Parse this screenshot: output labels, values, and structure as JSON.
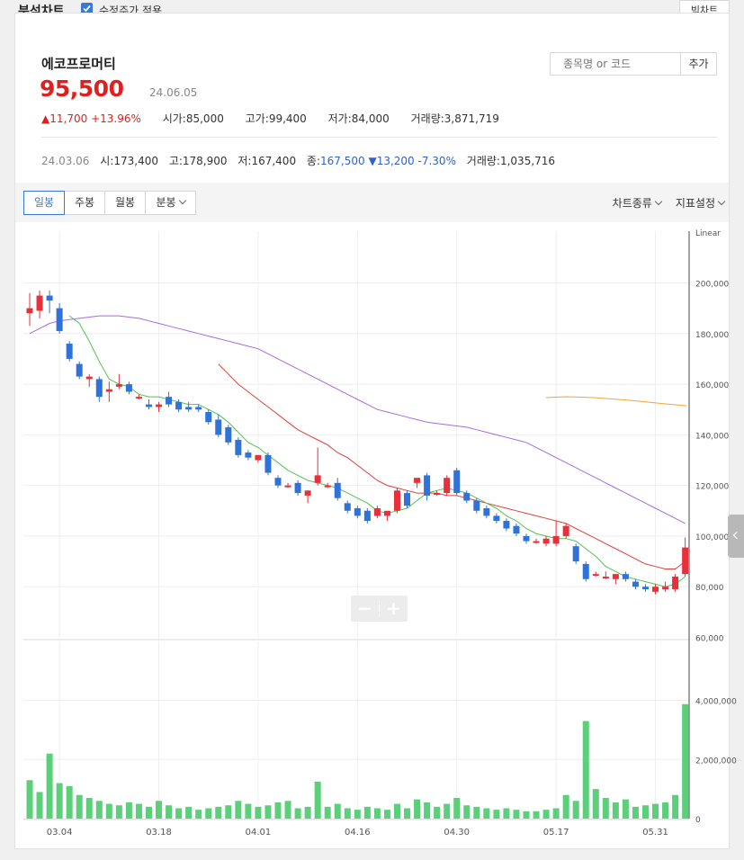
{
  "topbar": {
    "title": "분석차트",
    "adjusted_label": "수정주가 적용",
    "big_chart_button": "빅차트"
  },
  "stock": {
    "name": "에코프로머티",
    "price": "95,500",
    "date": "24.06.05",
    "change": "11,700",
    "change_pct": "+13.96%",
    "open_label": "시가",
    "open": "85,000",
    "high_label": "고가",
    "high": "99,400",
    "low_label": "저가",
    "low": "84,000",
    "volume_label": "거래량",
    "volume": "3,871,719"
  },
  "search": {
    "placeholder": "종목명 or 코드",
    "add_button": "추가"
  },
  "history": {
    "date": "24.03.06",
    "open_label": "시",
    "open": "173,400",
    "high_label": "고",
    "high": "178,900",
    "low_label": "저",
    "low": "167,400",
    "close_label": "종",
    "close": "167,500",
    "change": "13,200",
    "change_pct": "-7.30%",
    "volume_label": "거래량",
    "volume": "1,035,716"
  },
  "tabs": [
    {
      "label": "일봉",
      "active": true
    },
    {
      "label": "주봉",
      "active": false
    },
    {
      "label": "월봉",
      "active": false
    },
    {
      "label": "분봉",
      "active": false,
      "dropdown": true
    }
  ],
  "dropdowns": {
    "chart_type": "차트종류",
    "indicator": "지표설정"
  },
  "colors": {
    "up": "#e8303a",
    "down": "#2f73d9",
    "ma5": "#55c155",
    "ma20": "#e0403a",
    "ma60": "#a86ae0",
    "ma120": "#f2a23a",
    "volume": "#5ccf7a"
  },
  "chart_data": [
    {
      "type": "candlestick",
      "scale_label": "Linear",
      "ylim": [
        60000,
        200000
      ],
      "y_ticks": [
        60000,
        80000,
        100000,
        120000,
        140000,
        160000,
        180000,
        200000
      ],
      "y_tick_labels": [
        "60,000",
        "80,000",
        "100,000",
        "120,000",
        "140,000",
        "160,000",
        "180,000",
        "200,000"
      ],
      "x_tick_labels": [
        "03.04",
        "03.18",
        "04.01",
        "04.16",
        "04.30",
        "05.17",
        "05.31"
      ],
      "x_tick_index": [
        3,
        13,
        23,
        33,
        43,
        53,
        63
      ],
      "candles": [
        {
          "o": 188000,
          "h": 196000,
          "l": 183000,
          "c": 190000
        },
        {
          "o": 189000,
          "h": 197000,
          "l": 186000,
          "c": 195000
        },
        {
          "o": 195000,
          "h": 197000,
          "l": 188000,
          "c": 193000
        },
        {
          "o": 190000,
          "h": 192000,
          "l": 180000,
          "c": 181000
        },
        {
          "o": 176000,
          "h": 177000,
          "l": 169000,
          "c": 170000
        },
        {
          "o": 168000,
          "h": 169000,
          "l": 162000,
          "c": 163000
        },
        {
          "o": 162000,
          "h": 164000,
          "l": 159000,
          "c": 163000
        },
        {
          "o": 162000,
          "h": 163000,
          "l": 153000,
          "c": 155000
        },
        {
          "o": 157000,
          "h": 161000,
          "l": 153000,
          "c": 158000
        },
        {
          "o": 159000,
          "h": 164000,
          "l": 158000,
          "c": 160000
        },
        {
          "o": 160000,
          "h": 161000,
          "l": 156000,
          "c": 157000
        },
        {
          "o": 155000,
          "h": 156000,
          "l": 154000,
          "c": 155000
        },
        {
          "o": 152000,
          "h": 154000,
          "l": 150000,
          "c": 151000
        },
        {
          "o": 151000,
          "h": 153000,
          "l": 149000,
          "c": 152000
        },
        {
          "o": 155000,
          "h": 157000,
          "l": 151000,
          "c": 152000
        },
        {
          "o": 153000,
          "h": 154000,
          "l": 149000,
          "c": 150000
        },
        {
          "o": 151000,
          "h": 153000,
          "l": 149000,
          "c": 150000
        },
        {
          "o": 151000,
          "h": 152000,
          "l": 149000,
          "c": 150000
        },
        {
          "o": 149000,
          "h": 150000,
          "l": 144000,
          "c": 145000
        },
        {
          "o": 146000,
          "h": 148000,
          "l": 139000,
          "c": 140000
        },
        {
          "o": 143000,
          "h": 144000,
          "l": 136000,
          "c": 137000
        },
        {
          "o": 138000,
          "h": 139000,
          "l": 131000,
          "c": 132000
        },
        {
          "o": 133000,
          "h": 134000,
          "l": 130000,
          "c": 131000
        },
        {
          "o": 130000,
          "h": 132000,
          "l": 129000,
          "c": 132000
        },
        {
          "o": 132000,
          "h": 133000,
          "l": 124000,
          "c": 125000
        },
        {
          "o": 123000,
          "h": 124000,
          "l": 119000,
          "c": 120000
        },
        {
          "o": 120000,
          "h": 121000,
          "l": 119000,
          "c": 120000
        },
        {
          "o": 121000,
          "h": 122000,
          "l": 116000,
          "c": 117000
        },
        {
          "o": 116000,
          "h": 118000,
          "l": 113000,
          "c": 118000
        },
        {
          "o": 121000,
          "h": 135000,
          "l": 120000,
          "c": 124000
        },
        {
          "o": 120000,
          "h": 121000,
          "l": 119000,
          "c": 120000
        },
        {
          "o": 121000,
          "h": 123000,
          "l": 114000,
          "c": 115000
        },
        {
          "o": 113000,
          "h": 114000,
          "l": 109000,
          "c": 110000
        },
        {
          "o": 111000,
          "h": 112000,
          "l": 107000,
          "c": 108000
        },
        {
          "o": 110000,
          "h": 111000,
          "l": 105000,
          "c": 106000
        },
        {
          "o": 108000,
          "h": 112000,
          "l": 107000,
          "c": 111000
        },
        {
          "o": 108000,
          "h": 109000,
          "l": 106000,
          "c": 110000
        },
        {
          "o": 110000,
          "h": 119000,
          "l": 109000,
          "c": 118000
        },
        {
          "o": 117000,
          "h": 118000,
          "l": 111000,
          "c": 112000
        },
        {
          "o": 121000,
          "h": 123000,
          "l": 119000,
          "c": 123000
        },
        {
          "o": 124000,
          "h": 125000,
          "l": 114000,
          "c": 116000
        },
        {
          "o": 117000,
          "h": 118000,
          "l": 116000,
          "c": 117000
        },
        {
          "o": 117000,
          "h": 124000,
          "l": 116000,
          "c": 123000
        },
        {
          "o": 126000,
          "h": 127000,
          "l": 116000,
          "c": 117000
        },
        {
          "o": 117000,
          "h": 118000,
          "l": 113000,
          "c": 114000
        },
        {
          "o": 114000,
          "h": 115000,
          "l": 109000,
          "c": 110000
        },
        {
          "o": 111000,
          "h": 112000,
          "l": 107000,
          "c": 108000
        },
        {
          "o": 108000,
          "h": 109000,
          "l": 105000,
          "c": 106000
        },
        {
          "o": 106000,
          "h": 107000,
          "l": 102000,
          "c": 103000
        },
        {
          "o": 104000,
          "h": 105000,
          "l": 100000,
          "c": 101000
        },
        {
          "o": 100000,
          "h": 101000,
          "l": 97000,
          "c": 98000
        },
        {
          "o": 98000,
          "h": 99000,
          "l": 97000,
          "c": 98000
        },
        {
          "o": 97000,
          "h": 100000,
          "l": 96000,
          "c": 99000
        },
        {
          "o": 97000,
          "h": 106000,
          "l": 96000,
          "c": 100000
        },
        {
          "o": 100000,
          "h": 105000,
          "l": 99000,
          "c": 104000
        },
        {
          "o": 96000,
          "h": 97000,
          "l": 89000,
          "c": 90000
        },
        {
          "o": 89000,
          "h": 90000,
          "l": 82000,
          "c": 83000
        },
        {
          "o": 85000,
          "h": 86000,
          "l": 84000,
          "c": 85000
        },
        {
          "o": 84000,
          "h": 86000,
          "l": 83000,
          "c": 84000
        },
        {
          "o": 83000,
          "h": 85000,
          "l": 81000,
          "c": 85000
        },
        {
          "o": 85000,
          "h": 86000,
          "l": 82000,
          "c": 83000
        },
        {
          "o": 82000,
          "h": 83000,
          "l": 79000,
          "c": 80000
        },
        {
          "o": 80000,
          "h": 81000,
          "l": 78000,
          "c": 79000
        },
        {
          "o": 78000,
          "h": 81000,
          "l": 77000,
          "c": 80000
        },
        {
          "o": 79000,
          "h": 82000,
          "l": 78000,
          "c": 80000
        },
        {
          "o": 79000,
          "h": 85000,
          "l": 78000,
          "c": 84000
        },
        {
          "o": 85000,
          "h": 99400,
          "l": 84000,
          "c": 95500
        }
      ],
      "ma5": [
        null,
        null,
        null,
        null,
        187000,
        184000,
        177000,
        169000,
        162000,
        160000,
        159000,
        156000,
        155000,
        155000,
        154000,
        153000,
        152000,
        152000,
        150000,
        148000,
        145000,
        141000,
        137000,
        135000,
        132000,
        129000,
        126000,
        124000,
        122000,
        121000,
        120000,
        119000,
        117000,
        115000,
        113000,
        110000,
        109000,
        110000,
        111000,
        114000,
        117000,
        118000,
        119000,
        118000,
        117000,
        115000,
        113000,
        111000,
        108000,
        106000,
        103000,
        101000,
        100000,
        99000,
        99000,
        98000,
        95000,
        92000,
        88000,
        86000,
        84000,
        83000,
        82000,
        81000,
        80000,
        81000,
        84000
      ],
      "ma20": [
        null,
        null,
        null,
        null,
        null,
        null,
        null,
        null,
        null,
        null,
        null,
        null,
        null,
        null,
        null,
        null,
        null,
        null,
        null,
        168000,
        164000,
        160000,
        157000,
        154000,
        151000,
        148000,
        145000,
        142000,
        140000,
        138000,
        136000,
        133000,
        131000,
        128000,
        125000,
        122000,
        120000,
        119000,
        118000,
        117000,
        117000,
        117000,
        116000,
        116000,
        115000,
        114000,
        113000,
        112000,
        111000,
        110000,
        109000,
        108000,
        107000,
        106000,
        105000,
        103000,
        101000,
        99000,
        97000,
        95000,
        93000,
        91000,
        89000,
        88000,
        87000,
        87000,
        90000
      ],
      "ma60": [
        180000,
        182000,
        184000,
        185000,
        185500,
        186000,
        186500,
        187000,
        187000,
        187000,
        186500,
        186000,
        185000,
        184000,
        183000,
        182000,
        181000,
        180000,
        179000,
        178000,
        177000,
        176000,
        175000,
        174000,
        172000,
        170000,
        168000,
        166000,
        164000,
        162000,
        160000,
        158000,
        156000,
        154000,
        152000,
        150000,
        149000,
        148000,
        147000,
        146000,
        145000,
        144500,
        144000,
        143500,
        143000,
        142000,
        141000,
        140000,
        139000,
        138000,
        137000,
        135000,
        133000,
        131000,
        129000,
        127000,
        125000,
        123000,
        121000,
        119000,
        117000,
        115000,
        113000,
        111000,
        109000,
        107000,
        105000
      ],
      "ma120": [
        null,
        null,
        null,
        null,
        null,
        null,
        null,
        null,
        null,
        null,
        null,
        null,
        null,
        null,
        null,
        null,
        null,
        null,
        null,
        null,
        null,
        null,
        null,
        null,
        null,
        null,
        null,
        null,
        null,
        null,
        null,
        null,
        null,
        null,
        null,
        null,
        null,
        null,
        null,
        null,
        null,
        null,
        null,
        null,
        null,
        null,
        null,
        null,
        null,
        null,
        null,
        null,
        null,
        null,
        null,
        null,
        null,
        null,
        null,
        null,
        null,
        null,
        null,
        null,
        null,
        null,
        null
      ]
    },
    {
      "type": "bar",
      "ylim": [
        0,
        4000000
      ],
      "y_ticks": [
        0,
        2000000,
        4000000
      ],
      "y_tick_labels": [
        "0",
        "2,000,000",
        "4,000,000"
      ],
      "values": [
        1300000,
        900000,
        2200000,
        1200000,
        1100000,
        800000,
        700000,
        600000,
        500000,
        450000,
        550000,
        500000,
        400000,
        600000,
        450000,
        350000,
        400000,
        300000,
        350000,
        400000,
        450000,
        600000,
        500000,
        400000,
        450000,
        550000,
        600000,
        350000,
        400000,
        1250000,
        400000,
        500000,
        350000,
        300000,
        400000,
        350000,
        300000,
        500000,
        350000,
        650000,
        550000,
        400000,
        500000,
        700000,
        450000,
        400000,
        350000,
        300000,
        350000,
        300000,
        250000,
        250000,
        300000,
        350000,
        800000,
        600000,
        3300000,
        1000000,
        700000,
        550000,
        650000,
        400000,
        450000,
        500000,
        550000,
        800000,
        3871719
      ]
    }
  ]
}
